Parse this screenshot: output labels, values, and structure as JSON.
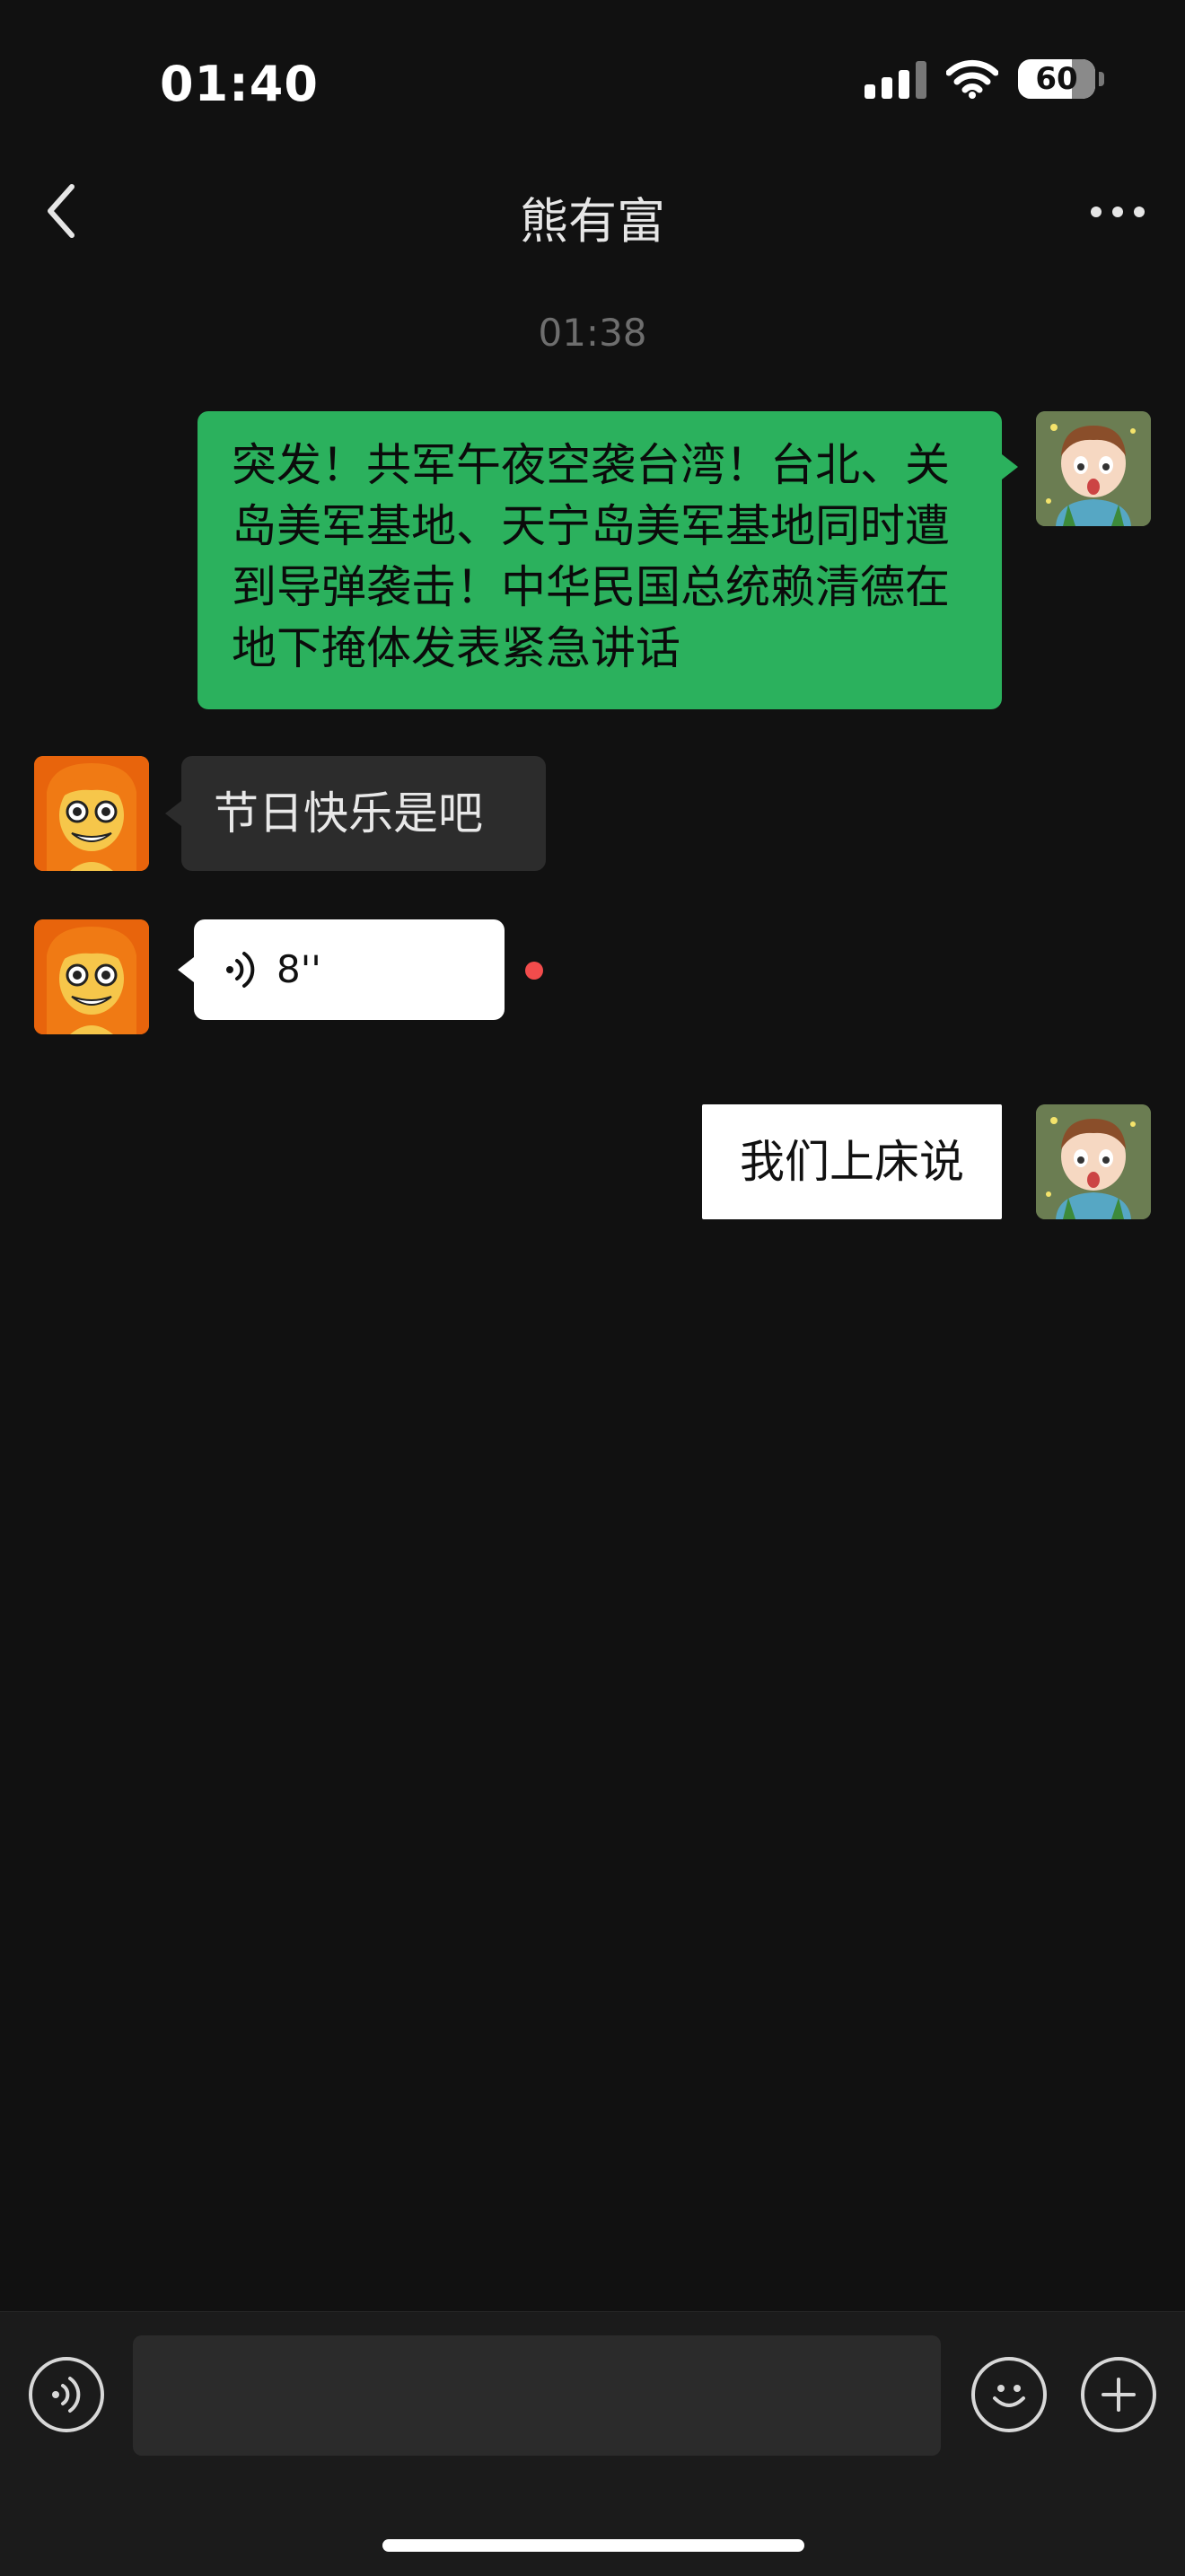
{
  "status_bar": {
    "time": "01:40",
    "battery": "60"
  },
  "nav": {
    "title": "熊有富"
  },
  "chat": {
    "timestamp": "01:38",
    "messages": [
      {
        "side": "right",
        "type": "text",
        "style": "green",
        "text": "突发！共军午夜空袭台湾！台北、关岛美军基地、天宁岛美军基地同时遭到导弹袭击！中华民国总统赖清德在地下掩体发表紧急讲话"
      },
      {
        "side": "left",
        "type": "text",
        "style": "dark",
        "text": "节日快乐是吧"
      },
      {
        "side": "left",
        "type": "voice",
        "duration": "8''",
        "unread": true
      },
      {
        "side": "right",
        "type": "text",
        "style": "white",
        "text": "我们上床说"
      }
    ]
  },
  "input": {
    "placeholder": ""
  },
  "icons": {
    "back": "chevron-left-icon",
    "more": "more-dots-icon",
    "voice_toggle": "voice-icon",
    "emoji": "emoji-icon",
    "add": "plus-icon"
  },
  "colors": {
    "background": "#111111",
    "green_bubble": "#2bb15d",
    "dark_bubble": "#2c2c2c",
    "unread": "#f24c4c"
  }
}
